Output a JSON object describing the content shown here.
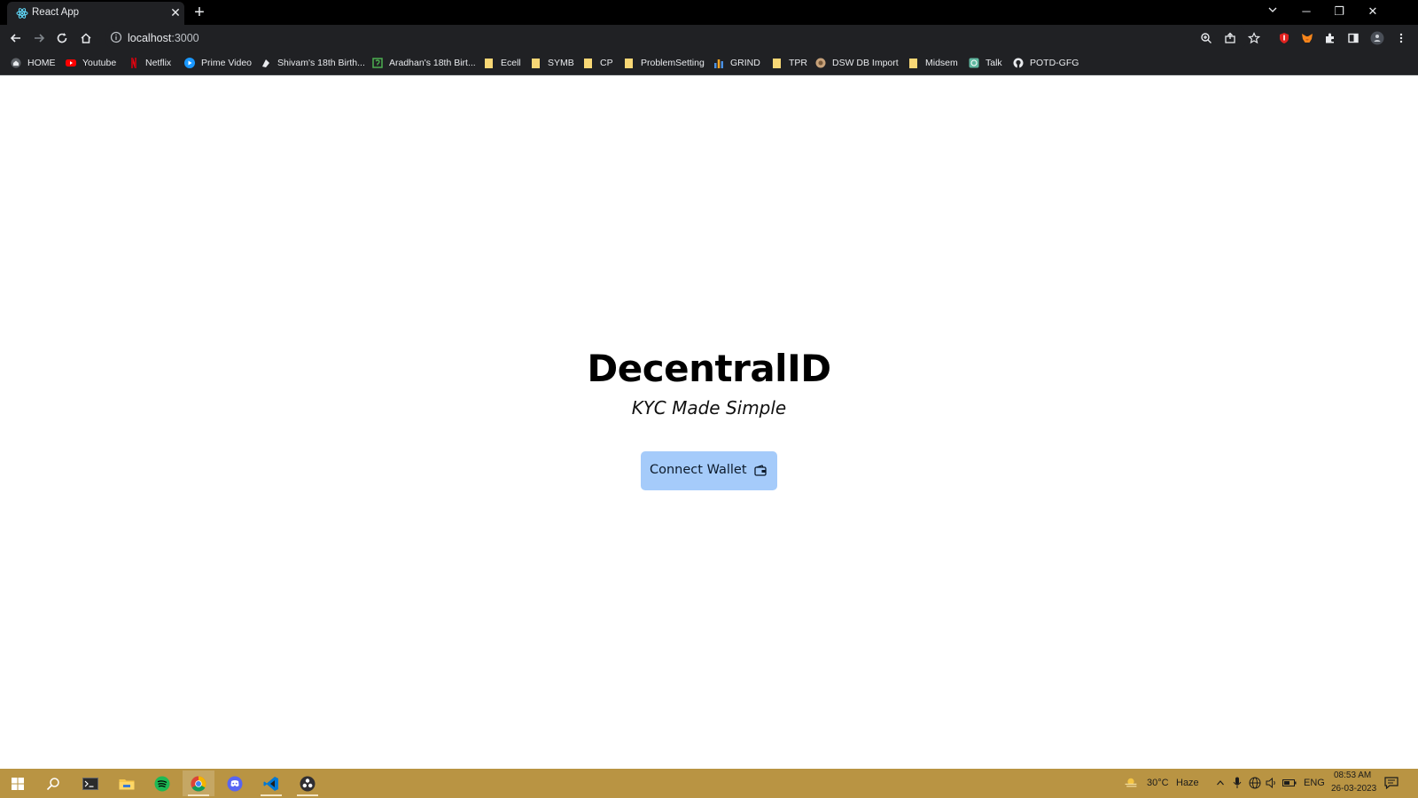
{
  "browser": {
    "tab": {
      "title": "React App",
      "close": "✕"
    },
    "new_tab": "+",
    "url": {
      "host": "localhost",
      "port": ":3000"
    },
    "window_controls": {
      "minimize": "─",
      "restore": "❐",
      "close": "✕"
    }
  },
  "bookmarks": [
    {
      "label": "HOME",
      "icon": "home-icon",
      "color": "#9aa0a6"
    },
    {
      "label": "Youtube",
      "icon": "youtube-icon",
      "color": "#ff0000"
    },
    {
      "label": "Netflix",
      "icon": "netflix-icon",
      "color": "#e50914"
    },
    {
      "label": "Prime Video",
      "icon": "prime-video-icon",
      "color": "#1a98ff"
    },
    {
      "label": "Shivam's 18th Birth...",
      "icon": "page-icon",
      "color": "#e8eaed"
    },
    {
      "label": "Aradhan's 18th Birt...",
      "icon": "page-icon",
      "color": "#4caf50"
    },
    {
      "label": "Ecell",
      "icon": "folder-icon",
      "color": "#f8d775"
    },
    {
      "label": "SYMB",
      "icon": "folder-icon",
      "color": "#f8d775"
    },
    {
      "label": "CP",
      "icon": "folder-icon",
      "color": "#f8d775"
    },
    {
      "label": "ProblemSetting",
      "icon": "folder-icon",
      "color": "#f8d775"
    },
    {
      "label": "GRIND",
      "icon": "chart-icon",
      "color": "#4a90e2"
    },
    {
      "label": "TPR",
      "icon": "folder-icon",
      "color": "#f8d775"
    },
    {
      "label": "DSW DB Import",
      "icon": "globe-icon",
      "color": "#c7a27a"
    },
    {
      "label": "Midsem",
      "icon": "folder-icon",
      "color": "#f8d775"
    },
    {
      "label": "Talk",
      "icon": "chat-icon",
      "color": "#5fb8a0"
    },
    {
      "label": "POTD-GFG",
      "icon": "github-icon",
      "color": "#e8eaed"
    }
  ],
  "main": {
    "title": "DecentralID",
    "subtitle": "KYC Made Simple",
    "connect_button": "Connect Wallet"
  },
  "taskbar": {
    "weather": {
      "temp": "30°C",
      "condition": "Haze"
    },
    "language": "ENG",
    "time": "08:53 AM",
    "date": "26-03-2023"
  },
  "colors": {
    "accent_button": "#a5cbfa",
    "taskbar": "#b99443",
    "browser_chrome": "#202124"
  }
}
